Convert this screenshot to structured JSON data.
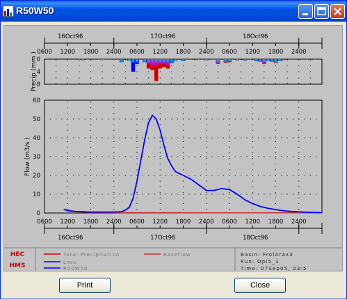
{
  "window": {
    "title": "R50W50"
  },
  "axes": {
    "date_labels": [
      "16Oct96",
      "17Oct96",
      "18Oct96"
    ],
    "time_ticks": [
      "0600",
      "1200",
      "1800",
      "2400",
      "0600",
      "1200",
      "1800",
      "2400",
      "0600",
      "1200",
      "1800",
      "2400"
    ],
    "precip_ylabel": "Precip (mm )",
    "precip_yticks": [
      "0",
      "4",
      "8"
    ],
    "flow_ylabel": "Flow (m3/s )",
    "flow_yticks": [
      "0",
      "10",
      "20",
      "30",
      "40",
      "50",
      "60"
    ]
  },
  "legend": {
    "total_precipitation": "Total Precipitation",
    "loss": "Loss",
    "r50w50": "R50W50",
    "baseflow": "Baseflow",
    "logo_top": "HEC",
    "logo_bottom": "HMS"
  },
  "info": {
    "basin": "Basin: FrolArax3",
    "run": "Run: Opl5_1",
    "time": "Time: 07Sep05, 03:5"
  },
  "buttons": {
    "print": "Print",
    "close": "Close"
  },
  "colors": {
    "flow": "#0000ff",
    "baseflow": "#c83232",
    "precip": "#cc0000",
    "loss": "#0000ff",
    "lossmix": "#cc00cc"
  },
  "chart_data": [
    {
      "type": "bar",
      "title": "",
      "xlabel": "",
      "ylabel": "Precip (mm )",
      "ylim": [
        8,
        0
      ],
      "x_unit": "hours from 16Oct96 0600",
      "series": [
        {
          "name": "Total Precipitation",
          "x": [
            9,
            10,
            15,
            18,
            20,
            22,
            23,
            24,
            26,
            27,
            28,
            29,
            30,
            31,
            32,
            33,
            34,
            36,
            38,
            40,
            42,
            45,
            47,
            48,
            50,
            52,
            55,
            56,
            57,
            58,
            59,
            60,
            61,
            62,
            70
          ],
          "values": [
            0.2,
            0.3,
            0.1,
            0.2,
            1.0,
            0.5,
            4.0,
            1.5,
            1.0,
            3.0,
            3.5,
            7.0,
            3.0,
            2.5,
            3.0,
            1.2,
            0.5,
            0.6,
            0.2,
            0.2,
            0.3,
            1.5,
            1.2,
            1.0,
            0.3,
            0.4,
            0.6,
            0.8,
            1.5,
            0.5,
            0.8,
            1.2,
            0.6,
            0.3,
            0.2
          ]
        },
        {
          "name": "Loss",
          "x": [
            9,
            10,
            15,
            18,
            20,
            22,
            23,
            24,
            26,
            27,
            28,
            29,
            30,
            31,
            32,
            33,
            34,
            36,
            38,
            40,
            42,
            45,
            47,
            48,
            50,
            52,
            55,
            56,
            57,
            58,
            59,
            60,
            61,
            62,
            70
          ],
          "values": [
            0.2,
            0.3,
            0.1,
            0.2,
            1.0,
            0.5,
            4.0,
            1.5,
            1.0,
            1.5,
            1.8,
            2.0,
            1.5,
            1.5,
            1.8,
            1.2,
            0.5,
            0.6,
            0.2,
            0.2,
            0.3,
            1.2,
            1.0,
            0.8,
            0.3,
            0.4,
            0.6,
            0.8,
            1.2,
            0.5,
            0.8,
            1.0,
            0.6,
            0.3,
            0.2
          ]
        }
      ]
    },
    {
      "type": "line",
      "title": "",
      "xlabel": "",
      "ylabel": "Flow (m3/s )",
      "ylim": [
        0,
        60
      ],
      "xlim": [
        0,
        72
      ],
      "x_unit": "hours from 16Oct96 0600",
      "grid": true,
      "series": [
        {
          "name": "R50W50",
          "x": [
            5,
            6,
            8,
            12,
            18,
            20,
            21,
            22,
            23,
            24,
            25,
            26,
            27,
            28,
            29,
            30,
            31,
            32,
            33,
            34,
            35,
            36,
            38,
            40,
            42,
            44,
            46,
            48,
            50,
            52,
            54,
            56,
            58,
            60,
            62,
            64,
            66,
            68,
            70,
            72
          ],
          "values": [
            2,
            1.2,
            0.8,
            0.5,
            0.5,
            0.7,
            1.5,
            3,
            8,
            17,
            28,
            39,
            48,
            52,
            50,
            44,
            36,
            29,
            25,
            22,
            21,
            20,
            18,
            15,
            12,
            12,
            13,
            12.5,
            10,
            7,
            5,
            3.5,
            2.5,
            1.8,
            1.2,
            0.8,
            0.6,
            0.4,
            0.3,
            0.2
          ]
        },
        {
          "name": "Baseflow",
          "x": [
            5,
            6,
            8,
            10,
            20,
            40,
            72
          ],
          "values": [
            2,
            1.5,
            0.8,
            0.4,
            0.2,
            0.1,
            0.1
          ]
        }
      ]
    }
  ]
}
